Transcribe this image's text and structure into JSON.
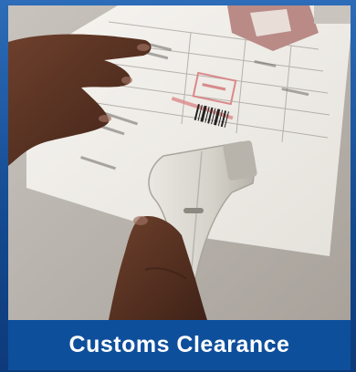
{
  "caption": "Customs Clearance",
  "photo": {
    "subject": "barcode-scanner",
    "alt": "",
    "colors": {
      "background": "#b9b3ad",
      "paper": "#f2f0ec",
      "skin": "#5a3323",
      "scanner": "#dcdad3",
      "stamp": "#d98a8a",
      "frame": "#13498f",
      "caption_bar": "#0e4f9c"
    }
  }
}
